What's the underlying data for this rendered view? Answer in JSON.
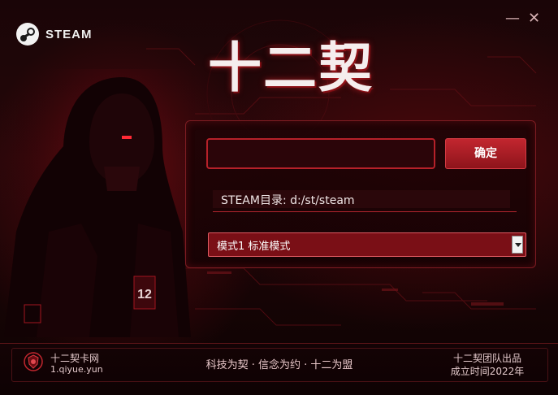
{
  "window": {
    "brand_label": "STEAM",
    "title": "十二契",
    "minimize_label": "—",
    "close_label": "✕"
  },
  "form": {
    "path_value": "",
    "confirm_label": "确定",
    "steam_dir_text": "STEAM目录: d:/st/steam",
    "mode_selected": "模式1 标准模式"
  },
  "footer": {
    "site_name": "十二契卡网",
    "site_url": "1.qiyue.yun",
    "slogan": "科技为契 · 信念为约 · 十二为盟",
    "team": "十二契团队出品",
    "founded": "成立时间2022年"
  },
  "decor": {
    "badge_number": "12"
  },
  "colors": {
    "accent": "#c2262f",
    "background": "#1a0507",
    "text": "#f0e6e6"
  },
  "icons": {
    "brand": "steam-logo-icon",
    "site": "shield-emblem-icon",
    "dropdown": "chevron-down-icon"
  }
}
